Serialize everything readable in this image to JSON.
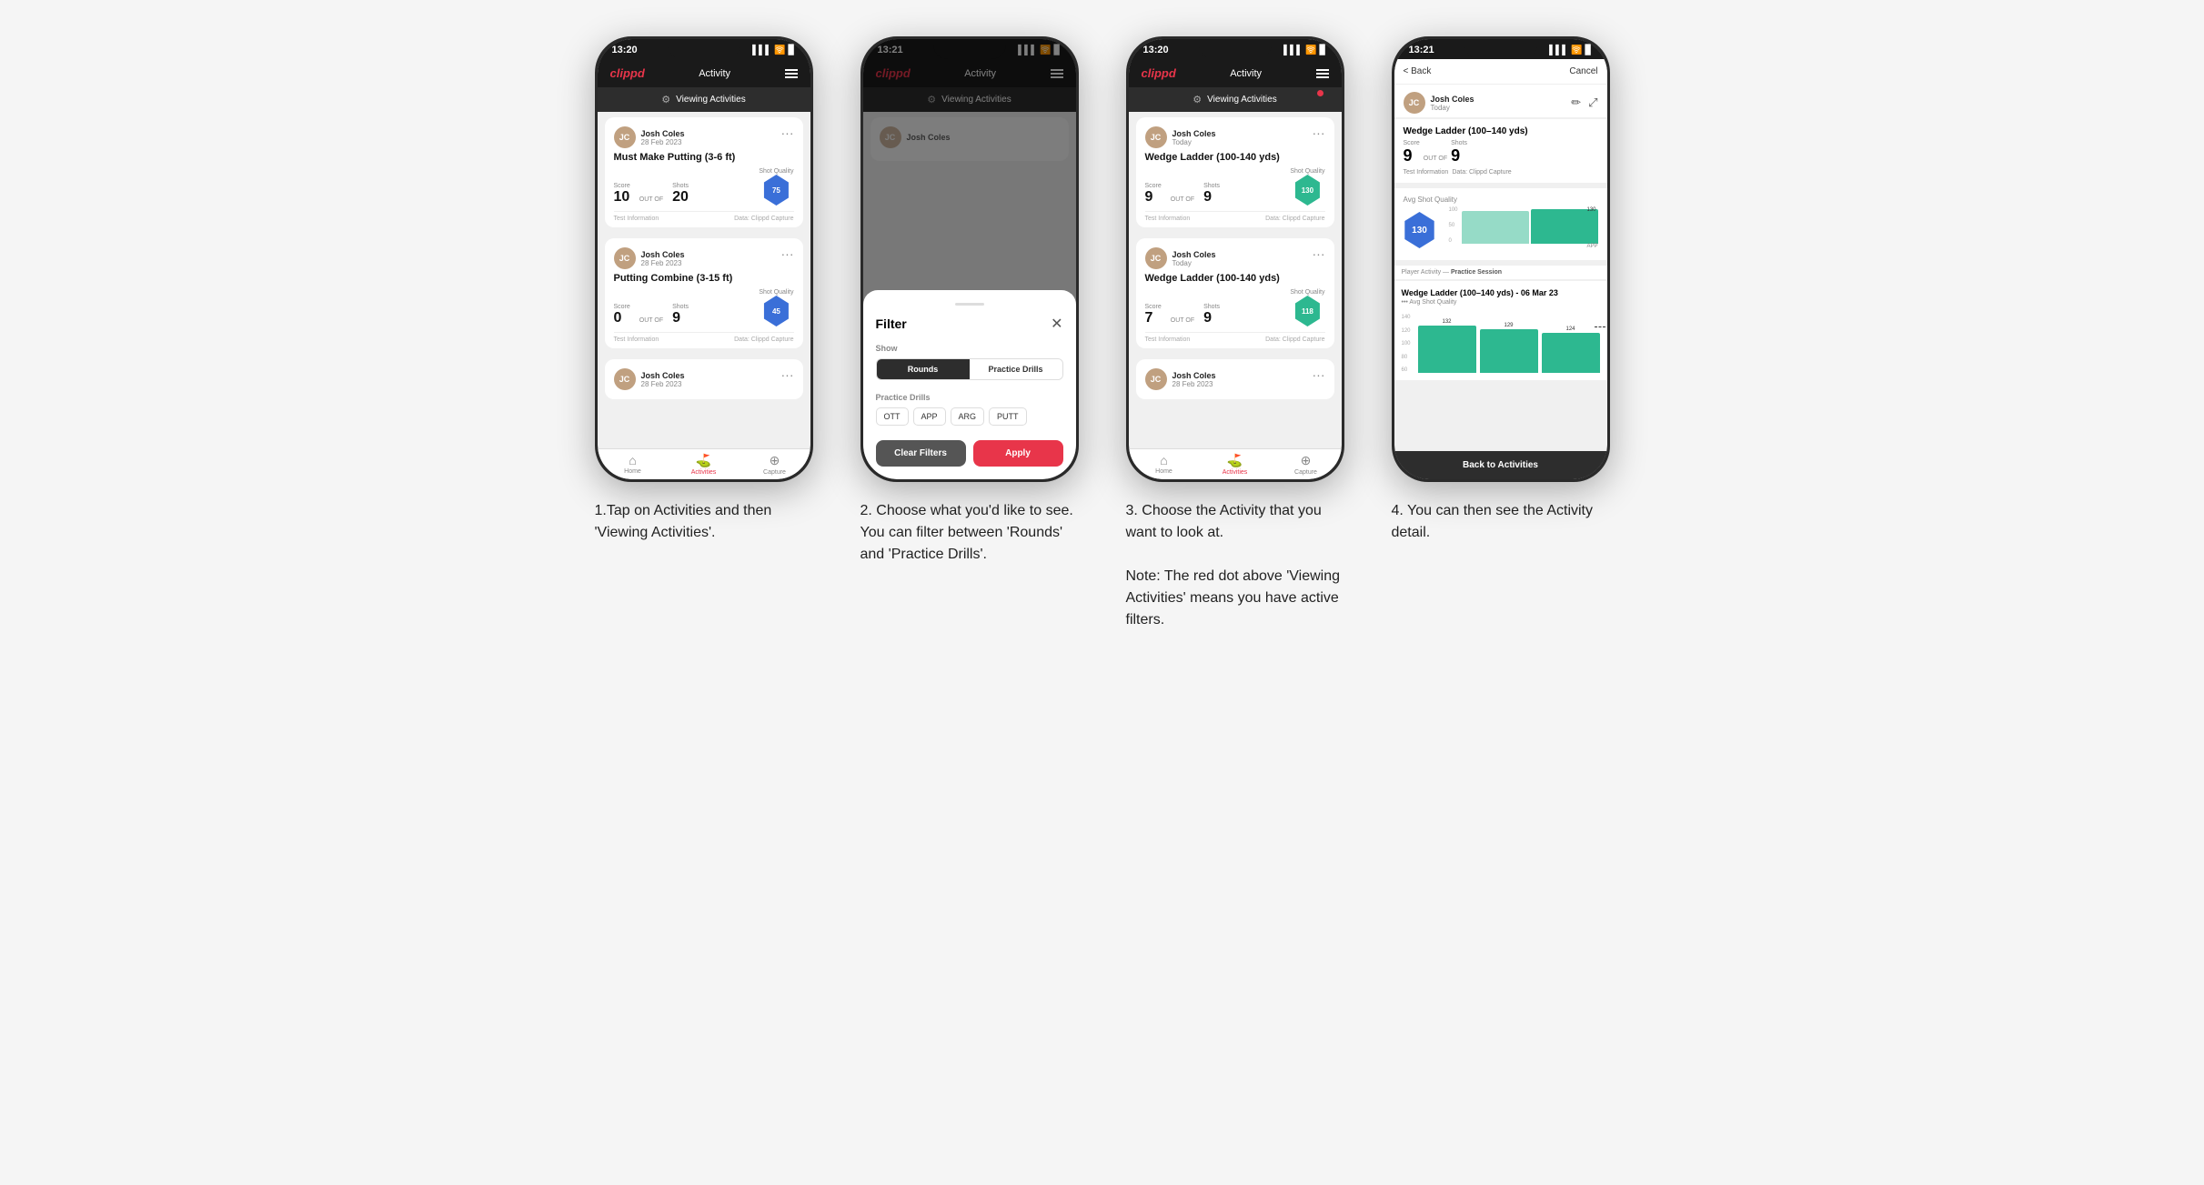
{
  "phones": [
    {
      "id": "phone1",
      "time": "13:20",
      "nav": {
        "logo": "clippd",
        "title": "Activity"
      },
      "viewing_bar": {
        "label": "Viewing Activities",
        "has_red_dot": false
      },
      "cards": [
        {
          "user": "Josh Coles",
          "date": "28 Feb 2023",
          "title": "Must Make Putting (3-6 ft)",
          "score_label": "Score",
          "shots_label": "Shots",
          "sq_label": "Shot Quality",
          "score": "10",
          "out_of": "OUT OF",
          "shots": "20",
          "sq": "75",
          "sq_type": "hex",
          "info": "Test Information",
          "data": "Data: Clippd Capture"
        },
        {
          "user": "Josh Coles",
          "date": "28 Feb 2023",
          "title": "Putting Combine (3-15 ft)",
          "score_label": "Score",
          "shots_label": "Shots",
          "sq_label": "Shot Quality",
          "score": "0",
          "out_of": "OUT OF",
          "shots": "9",
          "sq": "45",
          "sq_type": "hex",
          "info": "Test Information",
          "data": "Data: Clippd Capture"
        },
        {
          "user": "Josh Coles",
          "date": "28 Feb 2023",
          "title": "",
          "partial": true
        }
      ],
      "tabs": [
        {
          "icon": "🏠",
          "label": "Home",
          "active": false
        },
        {
          "icon": "⛳",
          "label": "Activities",
          "active": true
        },
        {
          "icon": "➕",
          "label": "Capture",
          "active": false
        }
      ]
    },
    {
      "id": "phone2",
      "time": "13:21",
      "nav": {
        "logo": "clippd",
        "title": "Activity"
      },
      "viewing_bar": {
        "label": "Viewing Activities",
        "has_red_dot": false
      },
      "filter": {
        "show_label": "Show",
        "tabs": [
          {
            "label": "Rounds",
            "active": true
          },
          {
            "label": "Practice Drills",
            "active": false
          }
        ],
        "practice_drills_label": "Practice Drills",
        "drill_tags": [
          "OTT",
          "APP",
          "ARG",
          "PUTT"
        ],
        "clear_label": "Clear Filters",
        "apply_label": "Apply"
      },
      "partial_card": {
        "user": "Josh Coles",
        "date": ""
      }
    },
    {
      "id": "phone3",
      "time": "13:20",
      "nav": {
        "logo": "clippd",
        "title": "Activity"
      },
      "viewing_bar": {
        "label": "Viewing Activities",
        "has_red_dot": true
      },
      "cards": [
        {
          "user": "Josh Coles",
          "date": "Today",
          "title": "Wedge Ladder (100-140 yds)",
          "score_label": "Score",
          "shots_label": "Shots",
          "sq_label": "Shot Quality",
          "score": "9",
          "out_of": "OUT OF",
          "shots": "9",
          "sq": "130",
          "sq_type": "hex_green",
          "info": "Test Information",
          "data": "Data: Clippd Capture"
        },
        {
          "user": "Josh Coles",
          "date": "Today",
          "title": "Wedge Ladder (100-140 yds)",
          "score_label": "Score",
          "shots_label": "Shots",
          "sq_label": "Shot Quality",
          "score": "7",
          "out_of": "OUT OF",
          "shots": "9",
          "sq": "118",
          "sq_type": "hex_green",
          "info": "Test Information",
          "data": "Data: Clippd Capture"
        },
        {
          "user": "Josh Coles",
          "date": "28 Feb 2023",
          "title": "",
          "partial": true
        }
      ],
      "tabs": [
        {
          "icon": "🏠",
          "label": "Home",
          "active": false
        },
        {
          "icon": "⛳",
          "label": "Activities",
          "active": true
        },
        {
          "icon": "➕",
          "label": "Capture",
          "active": false
        }
      ]
    },
    {
      "id": "phone4",
      "time": "13:21",
      "back_label": "< Back",
      "cancel_label": "Cancel",
      "user": "Josh Coles",
      "user_date": "Today",
      "wedge_title": "Wedge Ladder (100–140 yds)",
      "score_lbl": "Score",
      "shots_lbl": "Shots",
      "score_val": "9",
      "out_of": "OUT OF",
      "shots_val": "9",
      "sq_info_label": "Test Information",
      "sq_data_label": "Data: Clippd Capture",
      "avg_sq_label": "Avg Shot Quality",
      "sq_value": "130",
      "sq_chart_label": "130",
      "sq_chart_xlabel": "APP",
      "sq_chart_ylabel_max": "100",
      "sq_chart_ylabel_50": "50",
      "sq_chart_ylabel_0": "0",
      "practice_session": "Player Activity — Practice Session",
      "detail_title": "Wedge Ladder (100–140 yds) - 06 Mar 23",
      "detail_sublabel": "••• Avg Shot Quality",
      "bar_values": [
        132,
        129,
        124
      ],
      "bar_dashed": 124,
      "back_to_activities": "Back to Activities"
    }
  ],
  "descriptions": [
    {
      "id": "desc1",
      "text": "1.Tap on Activities and then 'Viewing Activities'."
    },
    {
      "id": "desc2",
      "text": "2. Choose what you'd like to see. You can filter between 'Rounds' and 'Practice Drills'."
    },
    {
      "id": "desc3",
      "text": "3. Choose the Activity that you want to look at.\n\nNote: The red dot above 'Viewing Activities' means you have active filters."
    },
    {
      "id": "desc4",
      "text": "4. You can then see the Activity detail."
    }
  ]
}
